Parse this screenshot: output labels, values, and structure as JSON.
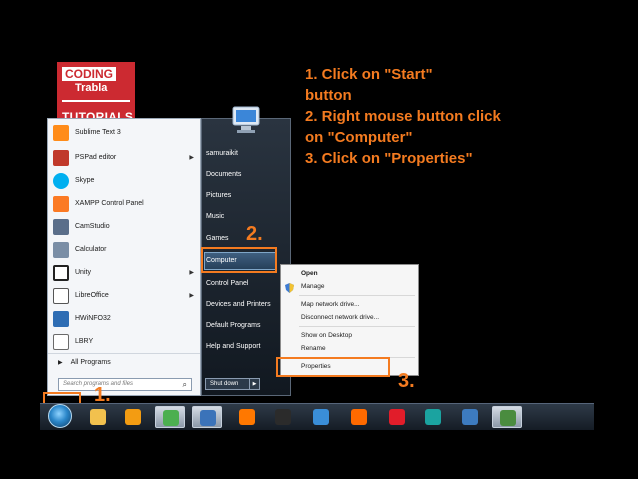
{
  "logo": {
    "line1": "CODING",
    "line2": "Trabla",
    "line3": "TUTORIALS"
  },
  "instructions": [
    "1. Click on \"Start\"",
    "button",
    "2. Right mouse button click",
    "on \"Computer\"",
    "3. Click on \"Properties\""
  ],
  "start_menu": {
    "programs": [
      {
        "label": "Sublime Text 3",
        "icon": "sublime-icon",
        "color": "#ff8c1a",
        "arrow": false
      },
      {
        "label": "PSPad editor",
        "icon": "pspad-icon",
        "color": "#c0392b",
        "arrow": true
      },
      {
        "label": "Skype",
        "icon": "skype-icon",
        "color": "#00aff0",
        "arrow": false
      },
      {
        "label": "XAMPP Control Panel",
        "icon": "xampp-icon",
        "color": "#fb7a24",
        "arrow": false
      },
      {
        "label": "CamStudio",
        "icon": "camstudio-icon",
        "color": "#5a6e8a",
        "arrow": false
      },
      {
        "label": "Calculator",
        "icon": "calculator-icon",
        "color": "#7a8ea6",
        "arrow": false
      },
      {
        "label": "Unity",
        "icon": "unity-icon",
        "color": "#222222",
        "arrow": true
      },
      {
        "label": "LibreOffice",
        "icon": "libreoffice-icon",
        "color": "#e8e8e8",
        "arrow": true
      },
      {
        "label": "HWiNFO32",
        "icon": "hwinfo-icon",
        "color": "#2e6db4",
        "arrow": false
      },
      {
        "label": "LBRY",
        "icon": "lbry-icon",
        "color": "#6a6a6a",
        "arrow": false
      }
    ],
    "all_programs": "All Programs",
    "search_placeholder": "Search programs and files",
    "right_items": [
      "samuraikit",
      "Documents",
      "Pictures",
      "Music",
      "Games",
      "Computer",
      "Control Panel",
      "Devices and Printers",
      "Default Programs",
      "Help and Support"
    ],
    "shutdown": "Shut down"
  },
  "context_menu": {
    "items": [
      "Open",
      "Manage",
      "Map network drive...",
      "Disconnect network drive...",
      "Show on Desktop",
      "Rename",
      "Properties"
    ]
  },
  "markers": {
    "one": "1.",
    "two": "2.",
    "three": "3."
  },
  "accent": "#f47b20",
  "taskbar": {
    "buttons": [
      {
        "icon": "explorer-icon",
        "color": "#f2c14e"
      },
      {
        "icon": "media-player-icon",
        "color": "#f39c12"
      },
      {
        "icon": "chrome-icon",
        "color": "#4caf50"
      },
      {
        "icon": "paint-icon",
        "color": "#3b73b9"
      },
      {
        "icon": "avast-icon",
        "color": "#ff7800"
      },
      {
        "icon": "intellij-icon",
        "color": "#2b2b2b"
      },
      {
        "icon": "network-icon",
        "color": "#3a8ed8"
      },
      {
        "icon": "firefox-icon",
        "color": "#ff6a00"
      },
      {
        "icon": "opera-icon",
        "color": "#e11d2a"
      },
      {
        "icon": "app-icon",
        "color": "#1ba3a0"
      },
      {
        "icon": "remote-icon",
        "color": "#3d7bbf"
      },
      {
        "icon": "monitor-icon",
        "color": "#4a8c3f"
      }
    ]
  }
}
